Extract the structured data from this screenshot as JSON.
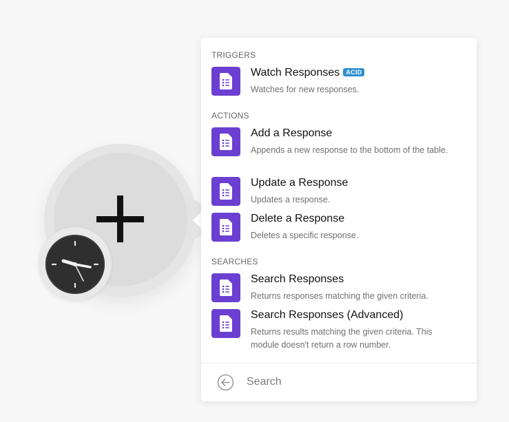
{
  "panel": {
    "sections": [
      {
        "label": "TRIGGERS",
        "items": [
          {
            "title": "Watch Responses",
            "badge": "ACID",
            "description": "Watches for new responses."
          }
        ]
      },
      {
        "label": "ACTIONS",
        "items": [
          {
            "title": "Add a Response",
            "description": "Appends a new response to the bottom of the table."
          },
          {
            "title": "Update a Response",
            "description": "Updates a response."
          },
          {
            "title": "Delete a Response",
            "description": "Deletes a specific response."
          }
        ]
      },
      {
        "label": "SEARCHES",
        "items": [
          {
            "title": "Search Responses",
            "description": "Returns responses matching the given criteria."
          },
          {
            "title": "Search Responses (Advanced)",
            "description": "Returns results matching the given criteria. This module doesn't return a row number."
          }
        ]
      }
    ],
    "search": {
      "placeholder": "Search"
    }
  },
  "icons": {
    "module_icon": "google-forms-icon",
    "back": "arrow-left-circle-icon",
    "trigger_module": "clock-icon",
    "add_module": "plus-icon"
  },
  "colors": {
    "forms_purple": "#6b3fd1",
    "acid_badge": "#2f8fd0",
    "background": "#f7f7f7"
  }
}
